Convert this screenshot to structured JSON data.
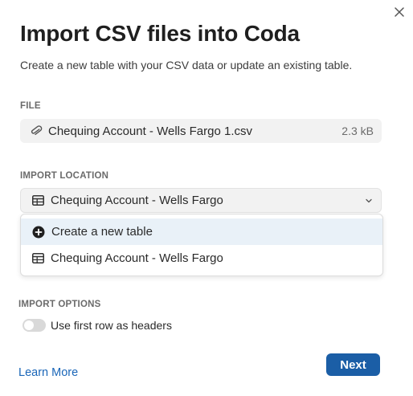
{
  "dialog": {
    "title": "Import CSV files into Coda",
    "subtitle": "Create a new table with your CSV data or update an existing table."
  },
  "file_section": {
    "label": "FILE",
    "file_name": "Chequing Account - Wells Fargo 1.csv",
    "file_size": "2.3 kB",
    "icon": "paperclip-icon"
  },
  "import_location": {
    "label": "IMPORT LOCATION",
    "selected_value": "Chequing Account - Wells Fargo",
    "selected_icon": "table-icon",
    "options": [
      {
        "label": "Create a new table",
        "icon": "plus-circle-icon",
        "highlighted": true
      },
      {
        "label": "Chequing Account - Wells Fargo",
        "icon": "table-icon",
        "highlighted": false
      }
    ]
  },
  "import_options": {
    "label": "IMPORT OPTIONS",
    "toggle_label": "Use first row as headers",
    "toggle_on": false
  },
  "footer": {
    "learn_more": "Learn More",
    "next": "Next"
  },
  "colors": {
    "primary": "#1b5ea6",
    "link": "#1a66b8",
    "highlight": "#e9f1f8"
  }
}
